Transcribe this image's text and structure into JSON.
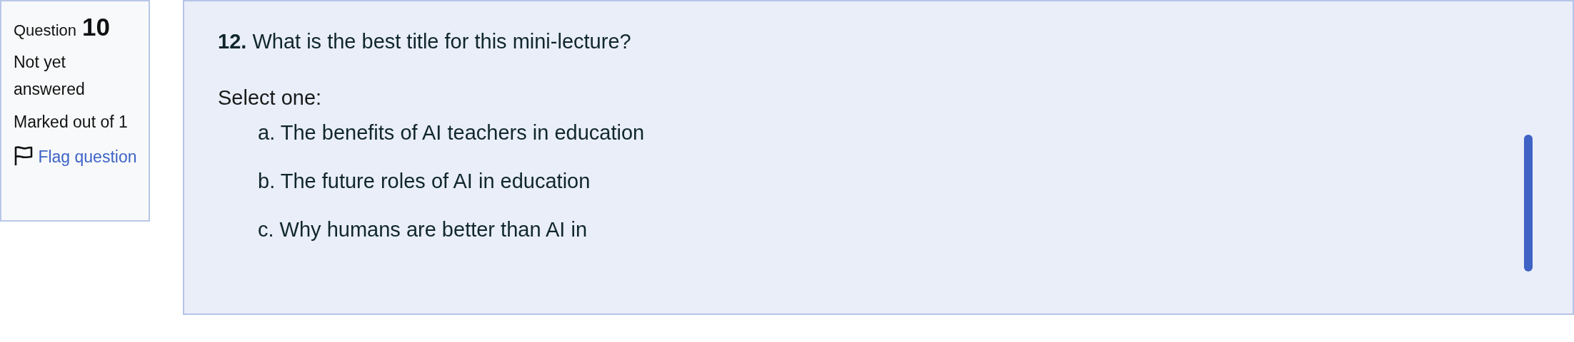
{
  "info": {
    "question_label": "Question",
    "question_number": "10",
    "status": "Not yet answered",
    "marks": "Marked out of 1",
    "flag_link": "Flag question"
  },
  "question": {
    "number": "12.",
    "text": "What is the best title for this mini-lecture?",
    "prompt": "Select one:",
    "options": [
      {
        "letter": "a.",
        "text": "The benefits of AI teachers in education"
      },
      {
        "letter": "b.",
        "text": "The future roles of AI in education"
      },
      {
        "letter": "c.",
        "text": "Why humans are better than AI in"
      }
    ]
  }
}
